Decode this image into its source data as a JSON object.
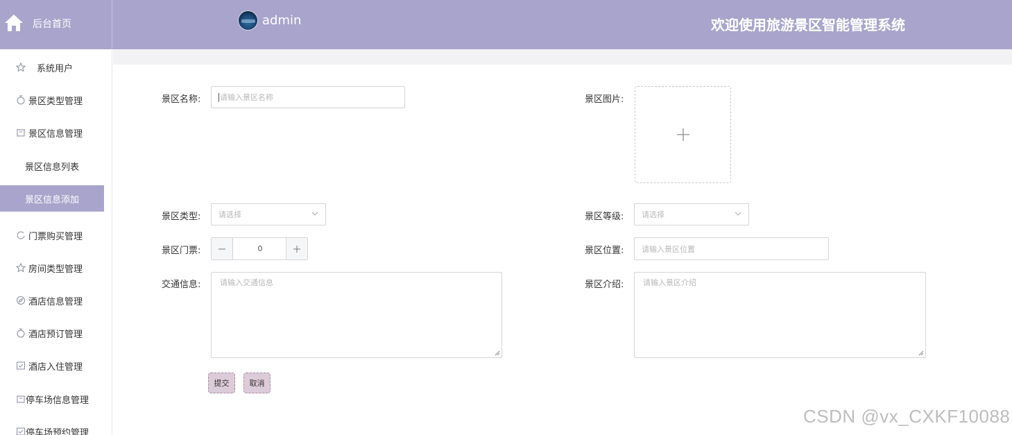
{
  "header": {
    "home_label": "后台首页",
    "username": "admin",
    "system_title": "欢迎使用旅游景区智能管理系统"
  },
  "sidebar": {
    "items": [
      {
        "label": "系统用户",
        "icon": "star-icon"
      },
      {
        "label": "景区类型管理",
        "icon": "timer-icon"
      },
      {
        "label": "景区信息管理",
        "icon": "box-icon"
      },
      {
        "label": "景区信息列表",
        "icon": ""
      },
      {
        "label": "景区信息添加",
        "icon": ""
      },
      {
        "label": "门票购买管理",
        "icon": "pie-icon"
      },
      {
        "label": "房间类型管理",
        "icon": "star-icon"
      },
      {
        "label": "酒店信息管理",
        "icon": "compass-icon"
      },
      {
        "label": "酒店预订管理",
        "icon": "timer-icon"
      },
      {
        "label": "酒店入住管理",
        "icon": "check-icon"
      },
      {
        "label": "停车场信息管理",
        "icon": "box-icon"
      },
      {
        "label": "停车场预约管理",
        "icon": "check-icon"
      }
    ],
    "active_index": 4
  },
  "form": {
    "name_label": "景区名称:",
    "name_placeholder": "请输入景区名称",
    "image_label": "景区图片:",
    "type_label": "景区类型:",
    "type_placeholder": "请选择",
    "level_label": "景区等级:",
    "level_placeholder": "请选择",
    "ticket_label": "景区门票:",
    "ticket_value": "0",
    "location_label": "景区位置:",
    "location_placeholder": "请输入景区位置",
    "traffic_label": "交通信息:",
    "traffic_placeholder": "请输入交通信息",
    "intro_label": "景区介绍:",
    "intro_placeholder": "请输入景区介绍",
    "submit_label": "提交",
    "cancel_label": "取消"
  },
  "watermark": "CSDN @vx_CXKF10088",
  "colors": {
    "header_bg": "#a9a4cb",
    "active_item_bg": "#a9a4cb",
    "button_bg": "#dcccd9"
  }
}
